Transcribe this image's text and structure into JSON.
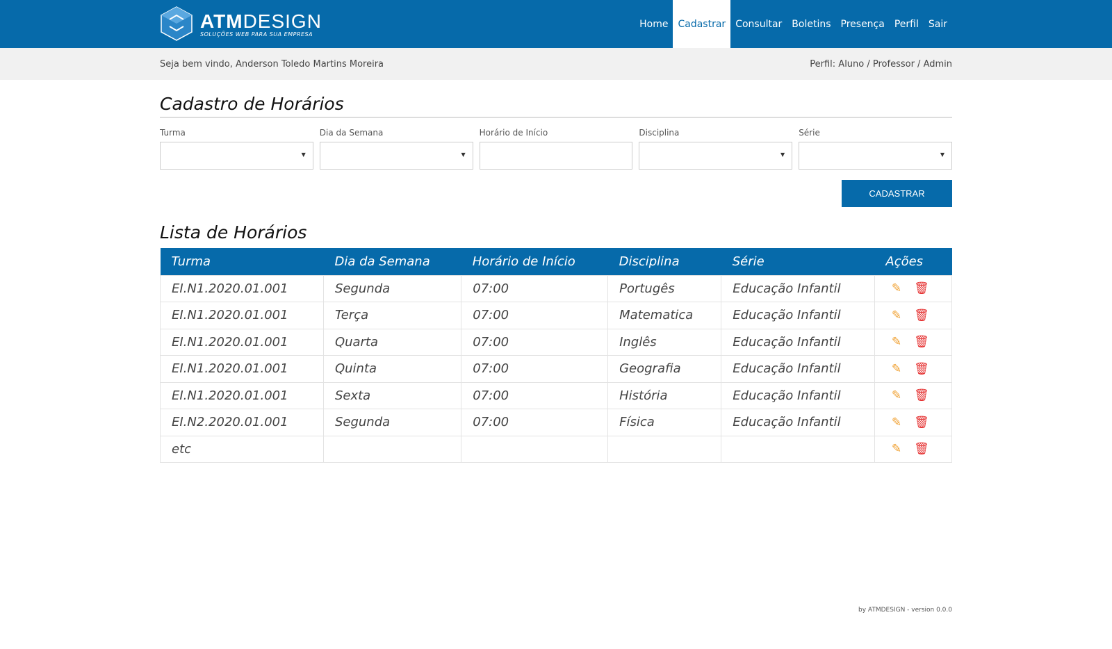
{
  "brand": {
    "name_bold": "ATM",
    "name_light": "DESIGN",
    "tagline": "SOLUÇÕES WEB PARA SUA EMPRESA"
  },
  "nav": [
    {
      "label": "Home"
    },
    {
      "label": "Cadastrar",
      "active": true
    },
    {
      "label": "Consultar"
    },
    {
      "label": "Boletins"
    },
    {
      "label": "Presença"
    },
    {
      "label": "Perfil"
    },
    {
      "label": "Sair"
    }
  ],
  "welcome": {
    "text": "Seja bem vindo, Anderson Toledo Martins Moreira",
    "profile": "Perfil: Aluno / Professor / Admin"
  },
  "form": {
    "title": "Cadastro de Horários",
    "fields": [
      {
        "label": "Turma",
        "type": "select",
        "value": ""
      },
      {
        "label": "Dia da Semana",
        "type": "select",
        "value": ""
      },
      {
        "label": "Horário de Início",
        "type": "text",
        "value": ""
      },
      {
        "label": "Disciplina",
        "type": "select",
        "value": ""
      },
      {
        "label": "Série",
        "type": "select",
        "value": ""
      }
    ],
    "submit": "CADASTRAR"
  },
  "list": {
    "title": "Lista de Horários",
    "columns": [
      "Turma",
      "Dia da Semana",
      "Horário de Início",
      "Disciplina",
      "Série",
      "Ações"
    ],
    "rows": [
      [
        "EI.N1.2020.01.001",
        "Segunda",
        "07:00",
        "Portugês",
        "Educação Infantil"
      ],
      [
        "EI.N1.2020.01.001",
        "Terça",
        "07:00",
        "Matematica",
        "Educação Infantil"
      ],
      [
        "EI.N1.2020.01.001",
        "Quarta",
        "07:00",
        "Inglês",
        "Educação Infantil"
      ],
      [
        "EI.N1.2020.01.001",
        "Quinta",
        "07:00",
        "Geografia",
        "Educação Infantil"
      ],
      [
        "EI.N1.2020.01.001",
        "Sexta",
        "07:00",
        "História",
        "Educação Infantil"
      ],
      [
        "EI.N2.2020.01.001",
        "Segunda",
        "07:00",
        "Física",
        "Educação Infantil"
      ],
      [
        "etc",
        "",
        "",
        "",
        ""
      ]
    ]
  },
  "footer": "by ATMDESIGN - version 0.0.0",
  "colors": {
    "primary": "#066aaa",
    "edit": "#f0a030",
    "delete": "#e53030"
  }
}
